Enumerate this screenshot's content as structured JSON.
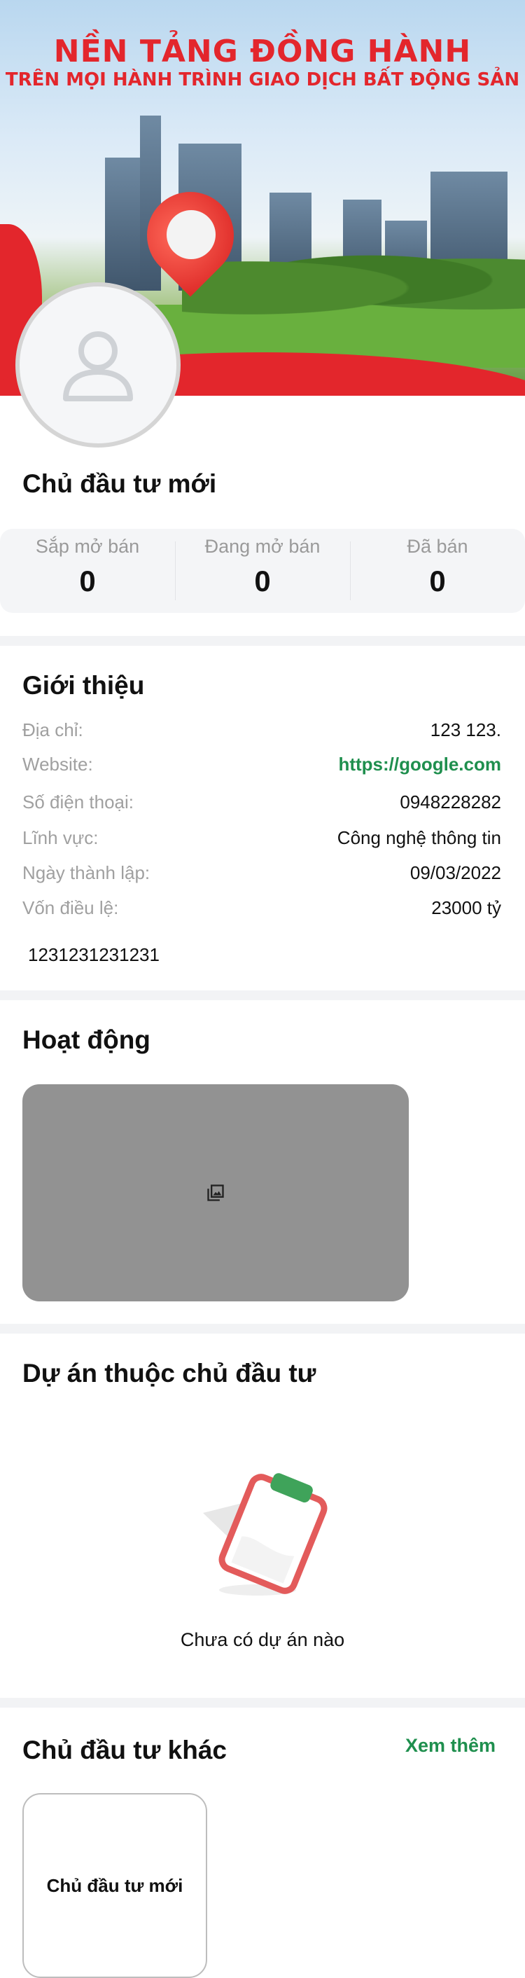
{
  "banner": {
    "title_line1": "NỀN TẢNG ĐỒNG HÀNH",
    "title_line2": "TRÊN MỌI HÀNH TRÌNH GIAO DỊCH BẤT ĐỘNG SẢN",
    "accent_color": "#e3262c"
  },
  "profile": {
    "name": "Chủ đầu tư mới",
    "avatar_icon": "user-placeholder-icon"
  },
  "stats": [
    {
      "label": "Sắp mở bán",
      "value": "0"
    },
    {
      "label": "Đang mở bán",
      "value": "0"
    },
    {
      "label": "Đã bán",
      "value": "0"
    }
  ],
  "intro": {
    "title": "Giới thiệu",
    "rows": [
      {
        "label": "Địa chỉ:",
        "value": "123 123."
      },
      {
        "label": "Website:",
        "value": "https://google.com"
      },
      {
        "label": "Số điện thoại:",
        "value": "0948228282"
      },
      {
        "label": "Lĩnh vực:",
        "value": "Công nghệ thông tin"
      },
      {
        "label": "Ngày thành lập:",
        "value": "09/03/2022"
      },
      {
        "label": "Vốn điều lệ:",
        "value": "23000 tỷ"
      }
    ],
    "description": "1231231231231"
  },
  "activity": {
    "title": "Hoạt động",
    "image_icon": "gallery-icon"
  },
  "projects": {
    "title": "Dự án thuộc chủ đầu tư",
    "empty_text": "Chưa có dự án nào",
    "empty_icon": "clipboard-icon"
  },
  "other": {
    "title": "Chủ đầu tư khác",
    "see_more": "Xem thêm",
    "cards": [
      {
        "name": "Chủ đầu tư mới"
      }
    ]
  },
  "colors": {
    "link_green": "#1f8f4e"
  }
}
